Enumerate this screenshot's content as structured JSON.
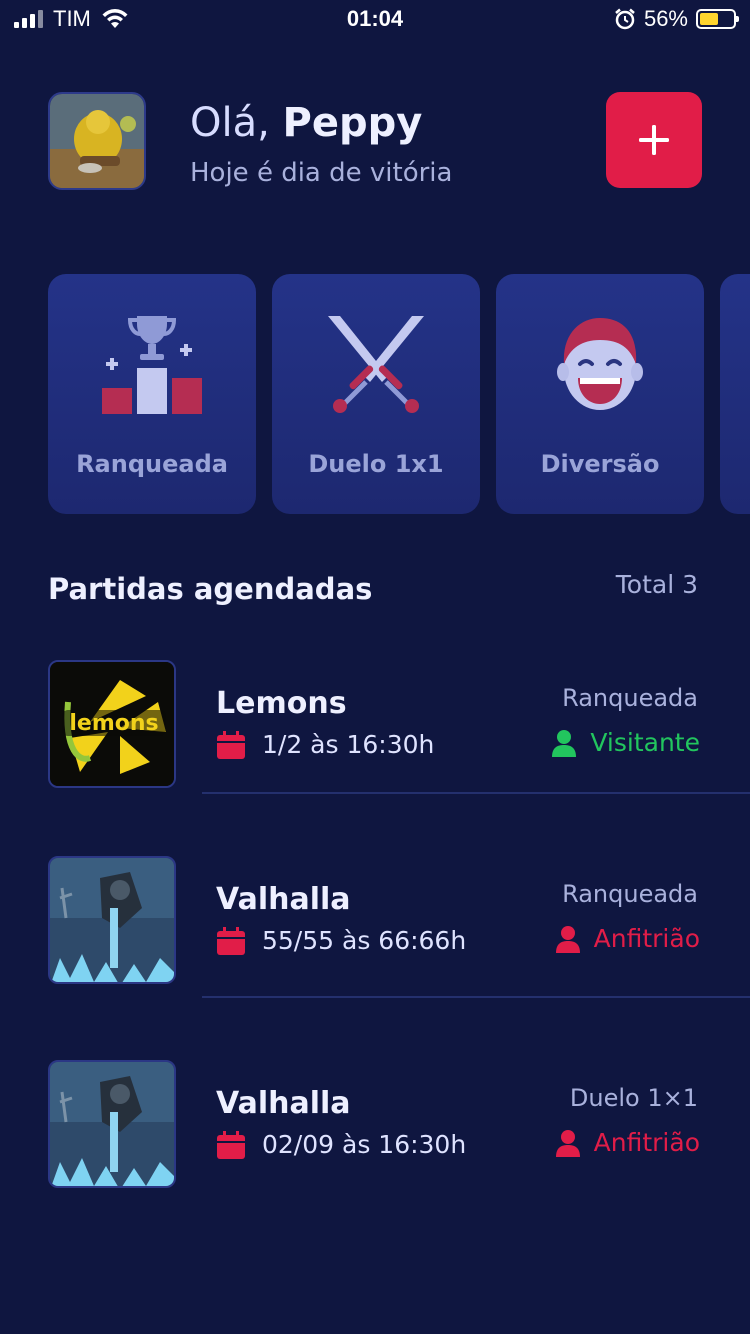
{
  "status": {
    "carrier": "TIM",
    "time": "01:04",
    "battery": "56%",
    "battery_color": "#ffd52e"
  },
  "header": {
    "greeting_prefix": "Olá,",
    "user_name": "Peppy",
    "subtitle": "Hoje é dia de vitória",
    "add_icon": "plus-icon"
  },
  "categories": [
    {
      "label": "Ranqueada",
      "icon": "podium-trophy-icon"
    },
    {
      "label": "Duelo 1x1",
      "icon": "crossed-swords-icon"
    },
    {
      "label": "Diversão",
      "icon": "laughing-face-icon"
    }
  ],
  "section": {
    "title": "Partidas agendadas",
    "total": "Total 3"
  },
  "matches": [
    {
      "name": "Lemons",
      "date": "1/2 às 16:30h",
      "type": "Ranqueada",
      "role": "Visitante",
      "role_color": "#22c55e"
    },
    {
      "name": "Valhalla",
      "date": "55/55 às 66:66h",
      "type": "Ranqueada",
      "role": "Anfitrião",
      "role_color": "#e11d48"
    },
    {
      "name": "Valhalla",
      "date": "02/09 às 16:30h",
      "type": "Duelo 1×1",
      "role": "Anfitrião",
      "role_color": "#e11d48"
    }
  ],
  "colors": {
    "background": "#0f1640",
    "accent": "#e11d48",
    "card": "#243388"
  }
}
